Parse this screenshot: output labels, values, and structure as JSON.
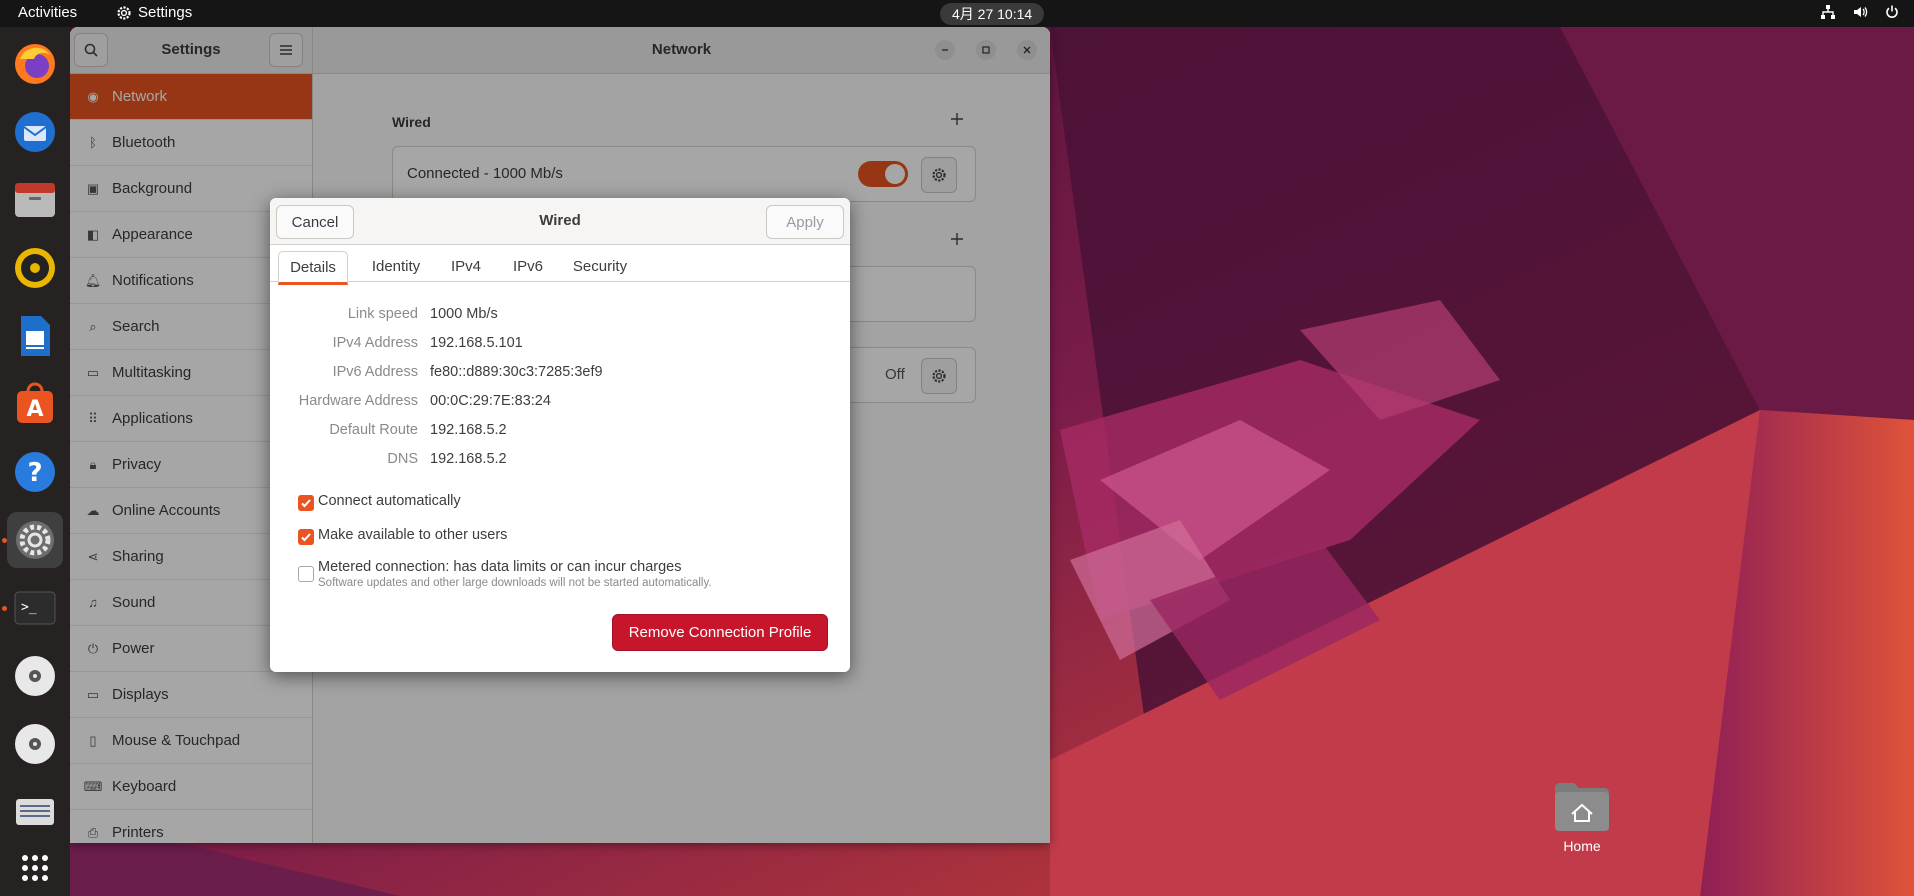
{
  "topbar": {
    "activities": "Activities",
    "app_name": "Settings",
    "clock": "4月 27  10:14",
    "tray_icons": [
      "network-icon",
      "volume-icon",
      "power-icon"
    ]
  },
  "dock": {
    "items": [
      "firefox-icon",
      "thunderbird-icon",
      "files-icon",
      "rhythmbox-icon",
      "writer-icon",
      "software-icon",
      "help-icon",
      "settings-icon",
      "terminal-icon",
      "disc-icon",
      "disc-icon",
      "drive-icon",
      "app-grid-icon"
    ],
    "active": "settings-icon"
  },
  "settings": {
    "sidebar_title": "Settings",
    "items": [
      {
        "label": "Network",
        "icon": "network-icon",
        "selected": true
      },
      {
        "label": "Bluetooth",
        "icon": "bluetooth-icon"
      },
      {
        "label": "Background",
        "icon": "background-icon"
      },
      {
        "label": "Appearance",
        "icon": "appearance-icon"
      },
      {
        "label": "Notifications",
        "icon": "bell-icon"
      },
      {
        "label": "Search",
        "icon": "search-icon"
      },
      {
        "label": "Multitasking",
        "icon": "multitasking-icon"
      },
      {
        "label": "Applications",
        "icon": "applications-icon"
      },
      {
        "label": "Privacy",
        "icon": "lock-icon"
      },
      {
        "label": "Online Accounts",
        "icon": "cloud-icon"
      },
      {
        "label": "Sharing",
        "icon": "share-icon"
      },
      {
        "label": "Sound",
        "icon": "music-icon"
      },
      {
        "label": "Power",
        "icon": "power-icon"
      },
      {
        "label": "Displays",
        "icon": "display-icon"
      },
      {
        "label": "Mouse & Touchpad",
        "icon": "mouse-icon"
      },
      {
        "label": "Keyboard",
        "icon": "keyboard-icon"
      },
      {
        "label": "Printers",
        "icon": "printer-icon"
      }
    ],
    "page_title": "Network",
    "wired_section": "Wired",
    "wired_status": "Connected - 1000 Mb/s",
    "vpn_off_label": "Off"
  },
  "dialog": {
    "title": "Wired",
    "cancel": "Cancel",
    "apply": "Apply",
    "tabs": [
      "Details",
      "Identity",
      "IPv4",
      "IPv6",
      "Security"
    ],
    "active_tab": "Details",
    "details": [
      {
        "key": "Link speed",
        "value": "1000 Mb/s"
      },
      {
        "key": "IPv4 Address",
        "value": "192.168.5.101"
      },
      {
        "key": "IPv6 Address",
        "value": "fe80::d889:30c3:7285:3ef9"
      },
      {
        "key": "Hardware Address",
        "value": "00:0C:29:7E:83:24"
      },
      {
        "key": "Default Route",
        "value": "192.168.5.2"
      },
      {
        "key": "DNS",
        "value": "192.168.5.2"
      }
    ],
    "connect_auto": "Connect automatically",
    "make_available": "Make available to other users",
    "metered": "Metered connection: has data limits or can incur charges",
    "metered_sub": "Software updates and other large downloads will not be started automatically.",
    "remove": "Remove Connection Profile"
  },
  "desktop": {
    "home_label": "Home"
  },
  "colors": {
    "accent": "#e95420",
    "danger": "#c7162b"
  }
}
